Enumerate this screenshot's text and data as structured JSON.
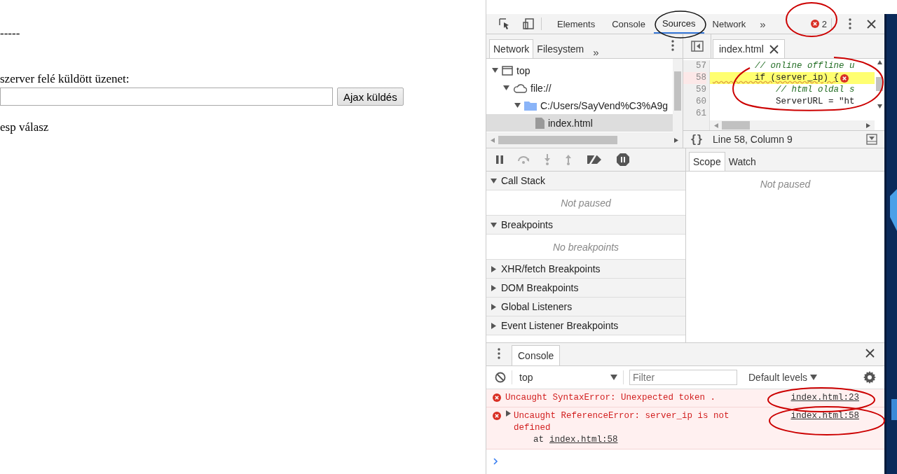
{
  "page": {
    "lines": [
      "-----"
    ],
    "label": "szerver felé küldött üzenet:",
    "button": "Ajax küldés",
    "response": "esp válasz"
  },
  "devtools": {
    "tabs": [
      {
        "label": "Elements",
        "selected": false
      },
      {
        "label": "Console",
        "selected": false
      },
      {
        "label": "Sources",
        "selected": true
      },
      {
        "label": "Network",
        "selected": false
      }
    ],
    "more_tabs": "»",
    "error_count": "2",
    "navigator": {
      "tabs": [
        {
          "label": "Network",
          "selected": true
        },
        {
          "label": "Filesystem",
          "selected": false
        }
      ],
      "more_tabs": "»",
      "tree": [
        {
          "kind": "frame",
          "label": "top",
          "expanded": true,
          "selected": false,
          "children": [
            {
              "kind": "cloud",
              "label": "file://",
              "expanded": true,
              "selected": false,
              "children": [
                {
                  "kind": "folder",
                  "label": "C:/Users/SayVend%C3%A9g",
                  "expanded": true,
                  "selected": false,
                  "children": [
                    {
                      "kind": "file",
                      "label": "index.html",
                      "selected": true
                    }
                  ]
                }
              ]
            }
          ]
        }
      ]
    },
    "editor": {
      "tab": "index.html",
      "lines": [
        {
          "number": "57",
          "text": "        // online offline u",
          "comment": true,
          "highlighted": false,
          "error": false
        },
        {
          "number": "58",
          "text": "        if (server_ip) {",
          "comment": false,
          "highlighted": true,
          "error": true
        },
        {
          "number": "59",
          "text": "            // html oldal s",
          "comment": true,
          "highlighted": false,
          "error": false
        },
        {
          "number": "60",
          "text": "            ServerURL = \"ht",
          "comment": false,
          "highlighted": false,
          "error": false
        },
        {
          "number": "61",
          "comment": false,
          "highlighted": false,
          "error": false
        }
      ],
      "pretty_print": "{}",
      "status": "Line 58, Column 9"
    },
    "sections": [
      {
        "title": "Call Stack",
        "expanded": true,
        "message": "Not paused"
      },
      {
        "title": "Breakpoints",
        "expanded": true,
        "message": "No breakpoints"
      },
      {
        "title": "XHR/fetch Breakpoints",
        "expanded": false
      },
      {
        "title": "DOM Breakpoints",
        "expanded": false
      },
      {
        "title": "Global Listeners",
        "expanded": false
      },
      {
        "title": "Event Listener Breakpoints",
        "expanded": false
      }
    ],
    "sidebar_tabs": [
      {
        "label": "Scope",
        "selected": true
      },
      {
        "label": "Watch",
        "selected": false
      }
    ],
    "sidebar_message": "Not paused",
    "console": {
      "tab": "Console",
      "context": "top",
      "filter": {
        "placeholder": "Filter"
      },
      "levels": "Default levels",
      "messages": [
        {
          "kind": "error",
          "expandable": false,
          "text": "Uncaught SyntaxError: Unexpected token .",
          "link": "index.html:23"
        },
        {
          "kind": "error",
          "expandable": true,
          "expanded": false,
          "text": "Uncaught ReferenceError: server_ip is not defined",
          "link": "index.html:58",
          "stack": {
            "prefix": "at",
            "link": "index.html:58"
          }
        }
      ]
    }
  }
}
